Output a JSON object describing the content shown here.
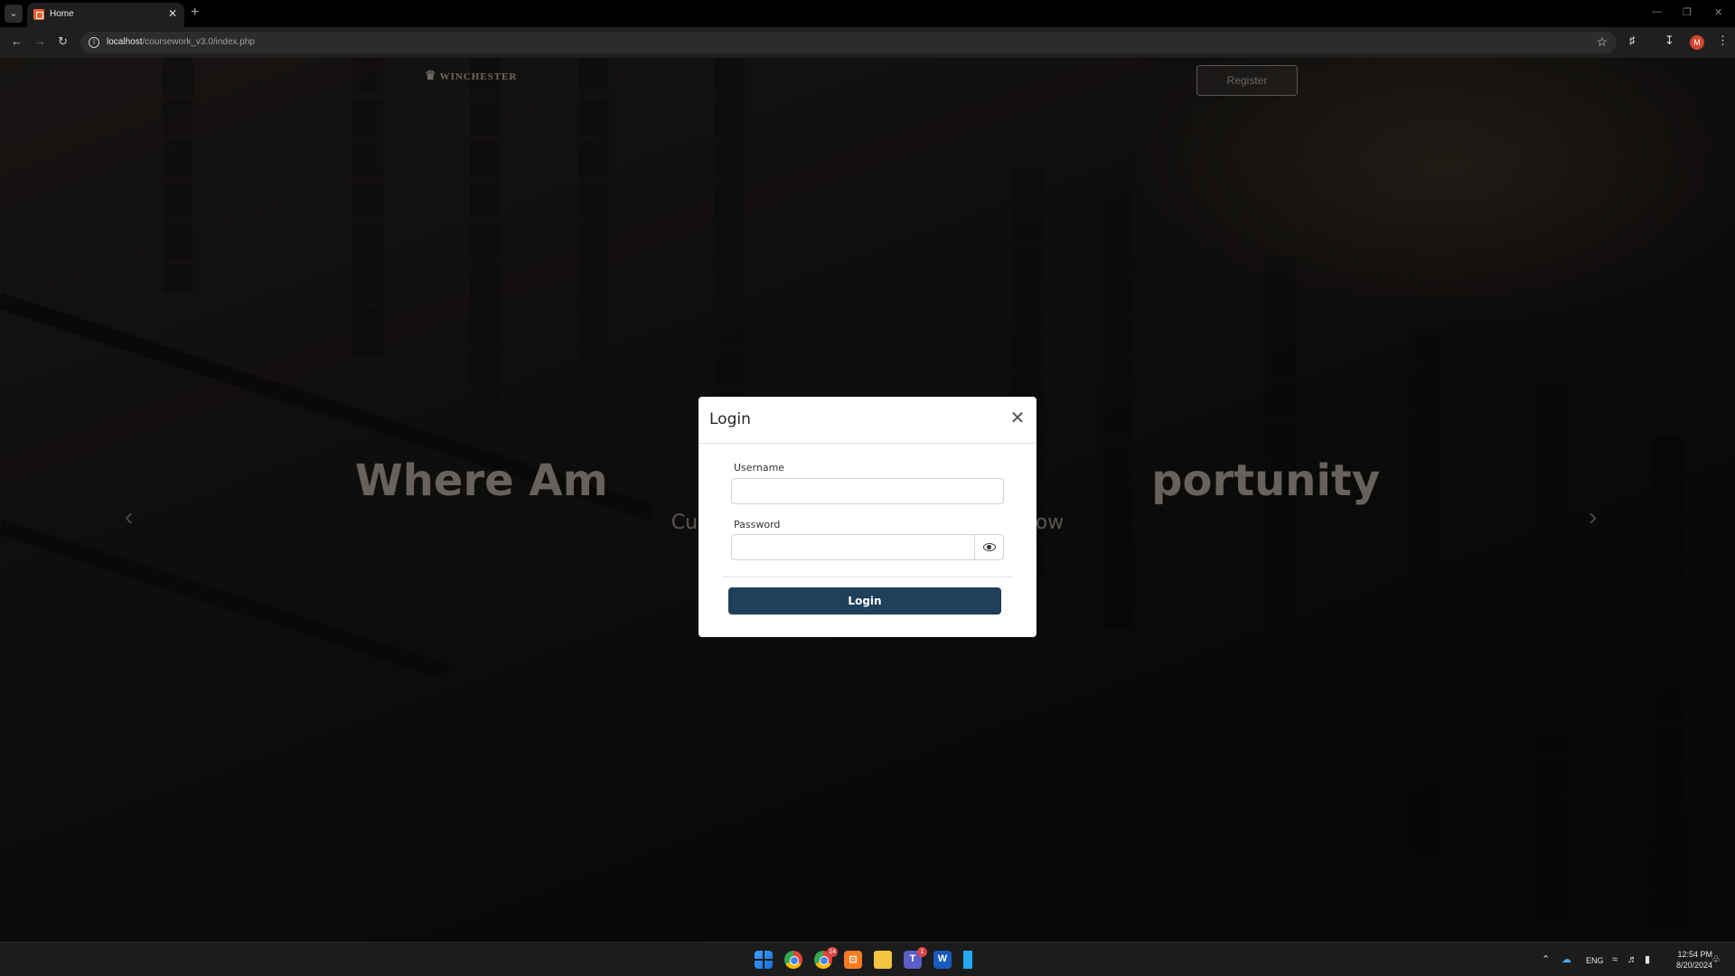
{
  "browser": {
    "tab_title": "Home",
    "url_host": "localhost",
    "url_path": "/coursework_v3.0/index.php"
  },
  "site": {
    "brand": "WINCHESTER",
    "register_label": "Register",
    "hero_title": "Where Am                                    portunity",
    "hero_subtitle": "Culti                                                rrow"
  },
  "modal": {
    "title": "Login",
    "username_label": "Username",
    "username_value": "",
    "password_label": "Password",
    "password_value": "",
    "login_label": "Login"
  },
  "taskbar": {
    "chrome_badge": "14",
    "teams_badge": "1",
    "language": "ENG",
    "time": "12:54 PM",
    "date": "8/20/2024"
  },
  "colors": {
    "login_button": "#1f3f5b",
    "profile_avatar": "#d2452e"
  }
}
